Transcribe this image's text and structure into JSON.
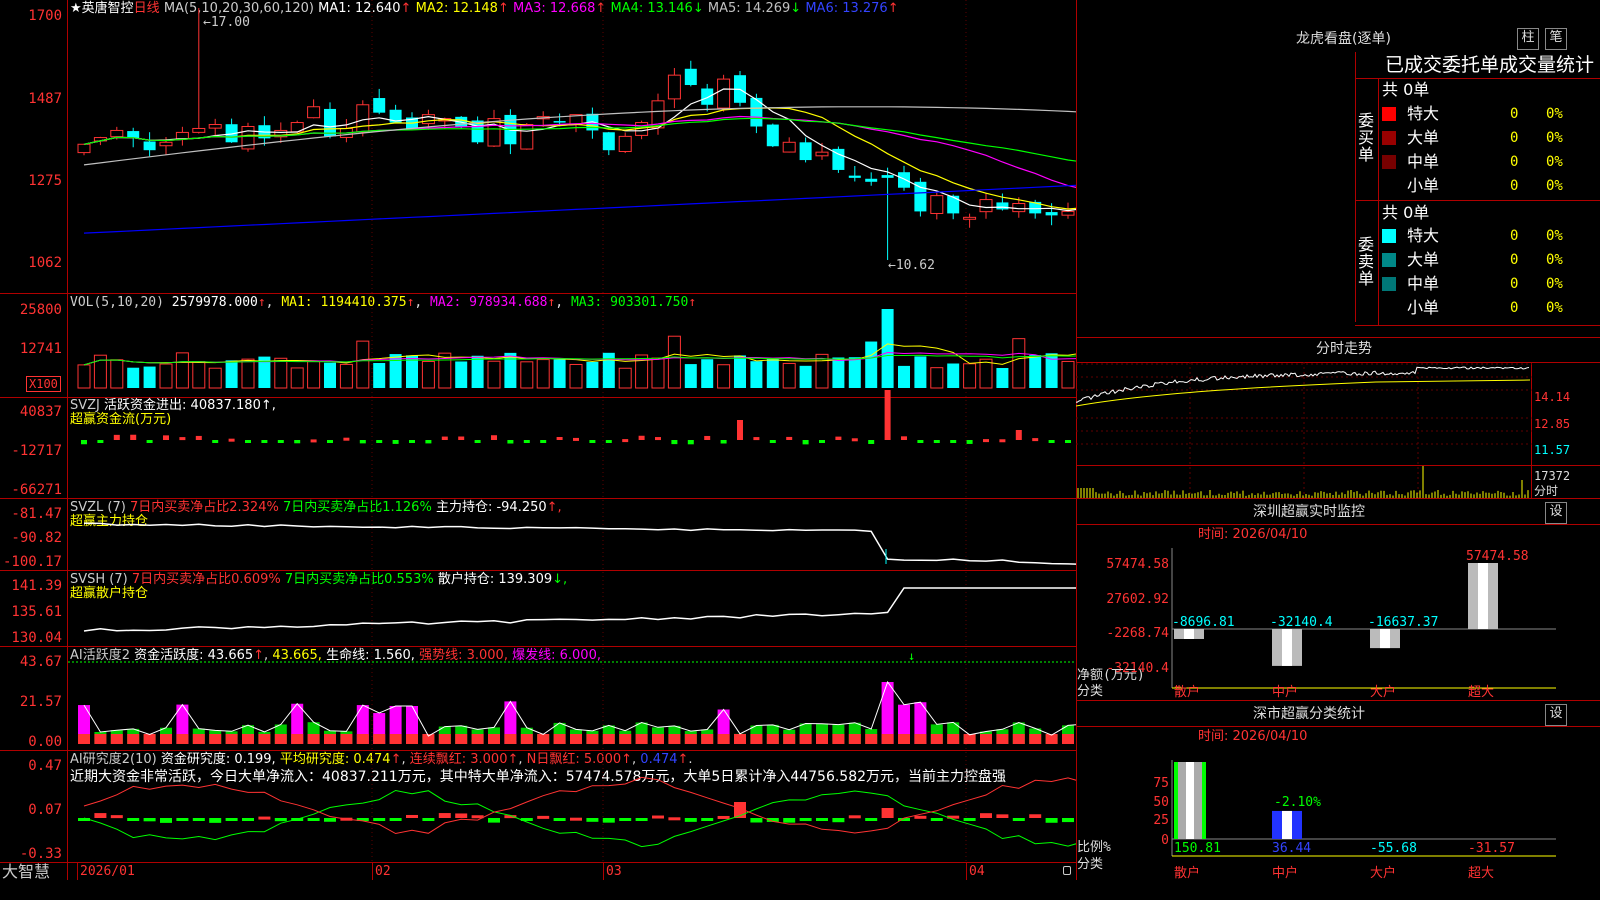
{
  "colors": {
    "up": "#ff3333",
    "down": "#00ffff",
    "ma1": "#ffffff",
    "ma2": "#ffff00",
    "ma3": "#ff00ff",
    "ma4": "#00ff00",
    "ma5": "#c0c0c0",
    "ma6": "#0000ff",
    "grid": "#b00000"
  },
  "main": {
    "star": "★",
    "stock": "英唐智控",
    "period": "日线",
    "ma_label": "MA(5,10,20,30,60,120)",
    "ma": [
      {
        "name": "MA1",
        "text": "MA1: 12.640",
        "arrow": "↑",
        "color": "#ffffff"
      },
      {
        "name": "MA2",
        "text": "MA2: 12.148",
        "arrow": "↑",
        "color": "#ffff00"
      },
      {
        "name": "MA3",
        "text": "MA3: 12.668",
        "arrow": "↑",
        "color": "#ff00ff"
      },
      {
        "name": "MA4",
        "text": "MA4: 13.146",
        "arrow": "↓",
        "color": "#00ff00"
      },
      {
        "name": "MA5",
        "text": "MA5: 14.269",
        "arrow": "↓",
        "color": "#c0c0c0"
      },
      {
        "name": "MA6",
        "text": "MA6: 13.276",
        "arrow": "↑",
        "color": "#0000ff"
      }
    ],
    "axis": [
      "1700",
      "1487",
      "1275",
      "1062"
    ],
    "high_label": "17.00",
    "low_label": "10.62"
  },
  "vol": {
    "label": "VOL(5,10,20)",
    "value": "2579978.000",
    "arrow": "↑",
    "ma1": "MA1: 1194410.375",
    "ma2": "MA2: 978934.688",
    "ma3": "MA3: 903301.750",
    "axis": [
      "25800",
      "12741"
    ],
    "unit": "X100"
  },
  "svzj": {
    "label": "SVZJ",
    "desc": "活跃资金进出: 40837.180",
    "tail": "↑,",
    "sub": "超赢资金流(万元)",
    "axis": [
      "40837",
      "-12717",
      "-66271"
    ]
  },
  "svzl": {
    "label": "SVZL (7)",
    "a": "7日内买卖净占比2.324%",
    "b": "7日内买卖净占比1.126%",
    "c": "主力持仓: -94.250",
    "tail": "↑,",
    "sub": "超赢主力持仓",
    "axis": [
      "-81.47",
      "-90.82",
      "-100.17"
    ]
  },
  "svsh": {
    "label": "SVSH (7)",
    "a": "7日内买卖净占比0.609%",
    "b": "7日内买卖净占比0.553%",
    "c": "散户持仓: 139.309",
    "tail": "↓,",
    "sub": "超赢散户持仓",
    "axis": [
      "141.39",
      "135.61",
      "130.04"
    ]
  },
  "ai1": {
    "label": "AI活跃度2",
    "a": "资金活跃度: 43.665",
    "b": "43.665,",
    "c": "生命线: 1.560,",
    "d": "强势线: 3.000,",
    "e": "爆发线: 6.000,",
    "axis": [
      "43.67",
      "21.57",
      "0.00"
    ]
  },
  "ai2": {
    "label": "AI研究度2(10)",
    "a": "资金研究度: 0.199,",
    "b": "平均研究度: 0.474",
    "c": "连续飘红: 3.000",
    "d": "N日飘红: 5.000",
    "e": "0.474",
    "summary": "近期大资金非常活跃，今日大单净流入：40837.211万元，其中特大单净流入：57474.578万元，大单5日累计净入44756.582万元，当前主力控盘强",
    "axis": [
      "0.47",
      "0.07",
      "-0.33"
    ]
  },
  "xaxis": {
    "logo": "大智慧",
    "labels": [
      "2026/01",
      "02",
      "03",
      "04"
    ]
  },
  "dragon": {
    "title": "龙虎看盘(逐单)",
    "btn1": "柱",
    "btn2": "笔",
    "tabs": "已成交委托单成交量统计",
    "buy_side": "委买单",
    "sell_side": "委卖单",
    "buy_total": "共 0单",
    "sell_total": "共 0单",
    "buy_rows": [
      {
        "name": "特大",
        "n": "0",
        "p": "0%",
        "c": "#ff0000"
      },
      {
        "name": "大单",
        "n": "0",
        "p": "0%",
        "c": "#990000"
      },
      {
        "name": "中单",
        "n": "0",
        "p": "0%",
        "c": "#770000"
      },
      {
        "name": "小单",
        "n": "0",
        "p": "0%",
        "c": "#000000"
      }
    ],
    "sell_rows": [
      {
        "name": "特大",
        "n": "0",
        "p": "0%",
        "c": "#00ffff"
      },
      {
        "name": "大单",
        "n": "0",
        "p": "0%",
        "c": "#008888"
      },
      {
        "name": "中单",
        "n": "0",
        "p": "0%",
        "c": "#007777"
      },
      {
        "name": "小单",
        "n": "0",
        "p": "0%",
        "c": "#000000"
      }
    ]
  },
  "intraday": {
    "title": "分时走势",
    "axis": [
      "14.14",
      "12.85",
      "11.57"
    ],
    "vol": "17372",
    "vol_label": "分时"
  },
  "monitor": {
    "title": "深圳超赢实时监控",
    "btn": "设",
    "time": "时间: 2026/04/10",
    "axis": [
      "57474.58",
      "27602.92",
      "-2268.74",
      "-32140.4"
    ],
    "ylabel": "净额(万元)",
    "xlabel": "分类",
    "bars": [
      {
        "cat": "散户",
        "value": "-8696.81"
      },
      {
        "cat": "中户",
        "value": "-32140.4"
      },
      {
        "cat": "大户",
        "value": "-16637.37"
      },
      {
        "cat": "超大",
        "value": "57474.58"
      }
    ]
  },
  "classify": {
    "title": "深市超赢分类统计",
    "btn": "设",
    "time": "时间: 2026/04/10",
    "ylabel": "比例%",
    "xlabel": "分类",
    "axis": [
      "75",
      "50",
      "25",
      "0"
    ],
    "bar2_label": "-2.10%",
    "cats": [
      {
        "cat": "散户",
        "value": "150.81"
      },
      {
        "cat": "中户",
        "value": "36.44"
      },
      {
        "cat": "大户",
        "value": "-55.68"
      },
      {
        "cat": "超大",
        "value": "-31.57"
      }
    ]
  },
  "chart_data": {
    "type": "candlestick",
    "title": "英唐智控 日线",
    "x_labels": [
      "2026/01",
      "02",
      "03",
      "04"
    ],
    "ylim": [
      10.62,
      17.0
    ],
    "closes": [
      13.55,
      13.72,
      13.9,
      13.7,
      13.4,
      13.6,
      13.85,
      13.95,
      14.05,
      13.6,
      14.0,
      13.7,
      13.9,
      14.1,
      14.5,
      13.75,
      13.95,
      14.55,
      14.35,
      14.1,
      13.95,
      14.3,
      14.2,
      14.0,
      13.6,
      14.2,
      13.55,
      14.05,
      14.25,
      14.1,
      14.3,
      13.9,
      13.4,
      13.75,
      14.1,
      14.65,
      15.3,
      15.05,
      14.55,
      15.2,
      14.6,
      14.0,
      13.5,
      13.6,
      13.15,
      13.35,
      12.9,
      12.7,
      12.6,
      12.7,
      12.45,
      11.85,
      12.25,
      11.8,
      11.7,
      12.15,
      11.9,
      12.05,
      11.8,
      11.75,
      11.85,
      12.2,
      12.05,
      12.55,
      12.35,
      11.7,
      11.25,
      11.3,
      11.6,
      11.1,
      11.5,
      11.45,
      11.6,
      11.55,
      11.4,
      11.3,
      11.45,
      11.6,
      11.75,
      12.2,
      12.95
    ]
  }
}
